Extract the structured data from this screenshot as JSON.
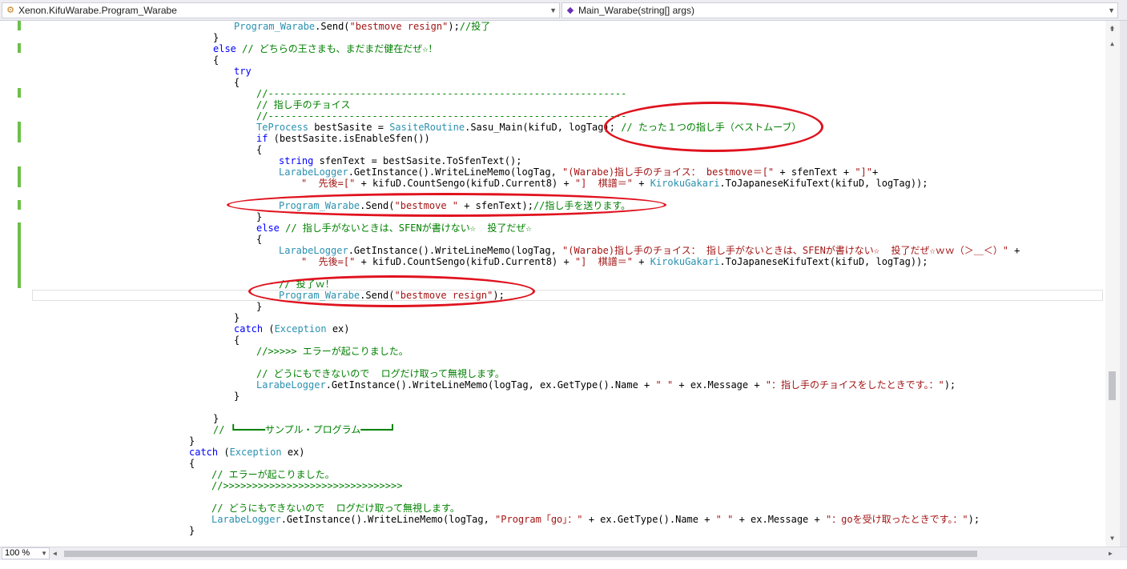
{
  "navbar": {
    "left_combo": {
      "icon": "class-icon",
      "text": "Xenon.KifuWarabe.Program_Warabe"
    },
    "right_combo": {
      "icon": "method-icon",
      "text": "Main_Warabe(string[] args)"
    }
  },
  "editor": {
    "lines": [
      [
        [
          "ty",
          "Program_Warabe"
        ],
        [
          "",
          "."
        ],
        [
          "",
          "Send("
        ],
        [
          "st",
          "\"bestmove resign\""
        ],
        [
          "",
          ");"
        ],
        [
          "cm",
          "//投了"
        ]
      ],
      [
        [
          "",
          "}"
        ]
      ],
      [
        [
          "kw",
          "else"
        ],
        [
          "",
          ""
        ],
        [
          "cm",
          " // どちらの王さまも、まだまだ健在だぜ☆！"
        ]
      ],
      [
        [
          "",
          "{"
        ]
      ],
      [
        [
          "kw",
          "try"
        ]
      ],
      [
        [
          "",
          "{"
        ]
      ],
      [
        [
          "cm",
          "//--------------------------------------------------------------"
        ]
      ],
      [
        [
          "cm",
          "// 指し手のチョイス"
        ]
      ],
      [
        [
          "cm",
          "//--------------------------------------------------------------"
        ]
      ],
      [
        [
          "ty",
          "TeProcess"
        ],
        [
          "",
          " bestSasite = "
        ],
        [
          "ty",
          "SasiteRoutine"
        ],
        [
          "",
          ".Sasu_Main(kifuD, logTag); "
        ],
        [
          "cm",
          "// たった１つの指し手（ベストムーブ）"
        ]
      ],
      [
        [
          "kw",
          "if"
        ],
        [
          "",
          " (bestSasite.isEnableSfen())"
        ]
      ],
      [
        [
          "",
          "{"
        ]
      ],
      [
        [
          "kw",
          "string"
        ],
        [
          "",
          " sfenText = bestSasite.ToSfenText();"
        ]
      ],
      [
        [
          "ty",
          "LarabeLogger"
        ],
        [
          "",
          ".GetInstance().WriteLineMemo(logTag, "
        ],
        [
          "st",
          "\"(Warabe)指し手のチョイス： bestmove＝[\""
        ],
        [
          "",
          " + sfenText + "
        ],
        [
          "st",
          "\"]\""
        ],
        [
          "",
          "+"
        ]
      ],
      [
        [
          "st",
          "\"  先後=[\""
        ],
        [
          "",
          " + kifuD.CountSengo(kifuD.Current8) + "
        ],
        [
          "st",
          "\"]  棋譜＝\""
        ],
        [
          "",
          " + "
        ],
        [
          "ty",
          "KirokuGakari"
        ],
        [
          "",
          ".ToJapaneseKifuText(kifuD, logTag));"
        ]
      ],
      [],
      [
        [
          "ty",
          "Program_Warabe"
        ],
        [
          "",
          ".Send("
        ],
        [
          "st",
          "\"bestmove \""
        ],
        [
          "",
          " + sfenText);"
        ],
        [
          "cm",
          "//指し手を送ります。"
        ]
      ],
      [
        [
          "",
          "}"
        ]
      ],
      [
        [
          "kw",
          "else"
        ],
        [
          "cm",
          " // 指し手がないときは、SFENが書けない☆  投了だぜ☆"
        ]
      ],
      [
        [
          "",
          "{"
        ]
      ],
      [
        [
          "ty",
          "LarabeLogger"
        ],
        [
          "",
          ".GetInstance().WriteLineMemo(logTag, "
        ],
        [
          "st",
          "\"(Warabe)指し手のチョイス： 指し手がないときは、SFENが書けない☆  投了だぜ☆ｗｗ（＞＿＜）\""
        ],
        [
          "",
          " +"
        ]
      ],
      [
        [
          "st",
          "\"  先後=[\""
        ],
        [
          "",
          " + kifuD.CountSengo(kifuD.Current8) + "
        ],
        [
          "st",
          "\"]  棋譜＝\""
        ],
        [
          "",
          " + "
        ],
        [
          "ty",
          "KirokuGakari"
        ],
        [
          "",
          ".ToJapaneseKifuText(kifuD, logTag));"
        ]
      ],
      [],
      [
        [
          "cm",
          "// 投了ｗ！"
        ]
      ],
      [
        [
          "ty",
          "Program_Warabe"
        ],
        [
          "",
          ".Send("
        ],
        [
          "st",
          "\"bestmove resign\""
        ],
        [
          "",
          ");"
        ]
      ],
      [
        [
          "",
          "}"
        ]
      ],
      [
        [
          "",
          "}"
        ]
      ],
      [
        [
          "kw",
          "catch"
        ],
        [
          "",
          " ("
        ],
        [
          "ty",
          "Exception"
        ],
        [
          "",
          " ex)"
        ]
      ],
      [
        [
          "",
          "{"
        ]
      ],
      [
        [
          "cm",
          "//>>>>> エラーが起こりました。"
        ]
      ],
      [],
      [
        [
          "cm",
          "// どうにもできないので  ログだけ取って無視します。"
        ]
      ],
      [
        [
          "ty",
          "LarabeLogger"
        ],
        [
          "",
          ".GetInstance().WriteLineMemo(logTag, ex.GetType().Name + "
        ],
        [
          "st",
          "\" \""
        ],
        [
          "",
          " + ex.Message + "
        ],
        [
          "st",
          "\"：指し手のチョイスをしたときです。：\""
        ],
        [
          "",
          ");"
        ]
      ],
      [
        [
          "",
          "}"
        ]
      ],
      [],
      [
        [
          "",
          "}"
        ]
      ],
      [
        [
          "cm",
          "// ┗━━━━━サンプル・プログラム━━━━━┛"
        ]
      ],
      [
        [
          "",
          "}"
        ]
      ],
      [
        [
          "kw",
          "catch"
        ],
        [
          "",
          " ("
        ],
        [
          "ty",
          "Exception"
        ],
        [
          "",
          " ex)"
        ]
      ],
      [
        [
          "",
          "{"
        ]
      ],
      [
        [
          "cm",
          "// エラーが起こりました。"
        ]
      ],
      [
        [
          "cm",
          "//>>>>>>>>>>>>>>>>>>>>>>>>>>>>>>>"
        ]
      ],
      [],
      [
        [
          "cm",
          "// どうにもできないので  ログだけ取って無視します。"
        ]
      ],
      [
        [
          "ty",
          "LarabeLogger"
        ],
        [
          "",
          ".GetInstance().WriteLineMemo(logTag, "
        ],
        [
          "st",
          "\"Program「go」：\""
        ],
        [
          "",
          " + ex.GetType().Name + "
        ],
        [
          "st",
          "\" \""
        ],
        [
          "",
          " + ex.Message + "
        ],
        [
          "st",
          "\"：goを受け取ったときです。：\""
        ],
        [
          "",
          ");"
        ]
      ],
      [
        [
          "",
          "}"
        ]
      ]
    ]
  },
  "statusbar": {
    "zoom": "100 %"
  },
  "colors": {
    "keyword": "#0000ff",
    "type": "#2b91af",
    "string": "#a31515",
    "comment": "#008000",
    "annotation": "#e0121e"
  }
}
